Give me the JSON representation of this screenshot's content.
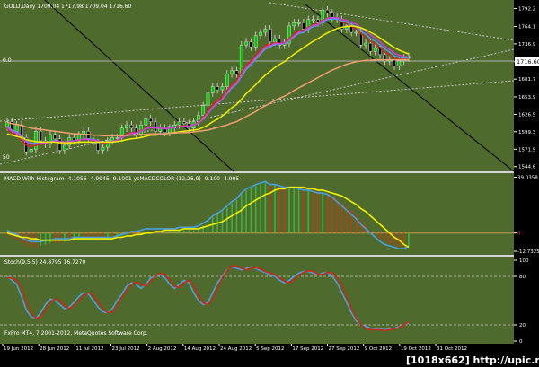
{
  "header": {
    "symbol_info": "GOLD,Daily  1709.04 1717.98 1709.04 1716.60",
    "macd_label": "MACD With Histogram -4.1056 -4.9945 -9.1001  ysMACDCOLOR (12,26,9) -9.100 -4.995",
    "stoch_label": "Stoch(9,5,5) 24.8795 16.7270",
    "copyright": "FxPro MT4, 7 2001-2012, MetaQuotes Software Corp.",
    "watermark": "[1018x662] http://upic.me/",
    "left_mark_top": "0.0",
    "left_mark_mid": "50"
  },
  "colors": {
    "panel_bg": "#4e6a2c",
    "axis_bg": "#000000",
    "candle_up": "#00c800",
    "candle_down": "#000000",
    "ma_red": "#cc2a10",
    "ma_blue": "#4aa0e0",
    "ma_magenta": "#d33fd3",
    "ma_yellow": "#f0f000",
    "ma_orange": "#f0a070",
    "macd_signal": "#f0f000",
    "macd_line": "#4aa0e0",
    "hist_green": "#3cb43c",
    "hist_red": "#c03c14",
    "stoch_main": "#4aa0e0",
    "stoch_signal": "#cc2a10",
    "current_price_badge": "#ffffff"
  },
  "chart_data": [
    {
      "type": "candlestick",
      "title": "GOLD,Daily",
      "y_ticks": [
        1792.2,
        1764.1,
        1736.9,
        1708.9,
        1681.7,
        1653.9,
        1626.5,
        1599.3,
        1571.9,
        1544.6
      ],
      "current_price": 1716.6,
      "ylim": [
        1540,
        1800
      ],
      "x_labels": [
        "19 Jun 2012",
        "28 Jun 2012",
        "11 Jul 2012",
        "23 Jul 2012",
        "2 Aug 2012",
        "14 Aug 2012",
        "24 Aug 2012",
        "5 Sep 2012",
        "17 Sep 2012",
        "27 Sep 2012",
        "9 Oct 2012",
        "19 Oct 2012",
        "31 Oct 2012"
      ],
      "series": [
        {
          "name": "close",
          "values": [
            1615,
            1600,
            1610,
            1590,
            1568,
            1572,
            1600,
            1585,
            1580,
            1595,
            1588,
            1570,
            1578,
            1590,
            1585,
            1594,
            1600,
            1588,
            1582,
            1570,
            1575,
            1585,
            1590,
            1590,
            1605,
            1610,
            1605,
            1595,
            1610,
            1620,
            1615,
            1600,
            1605,
            1598,
            1605,
            1610,
            1615,
            1612,
            1605,
            1615,
            1625,
            1640,
            1660,
            1670,
            1665,
            1670,
            1690,
            1695,
            1690,
            1735,
            1740,
            1732,
            1750,
            1755,
            1760,
            1740,
            1745,
            1735,
            1738,
            1765,
            1770,
            1770,
            1760,
            1775,
            1775,
            1770,
            1790,
            1785,
            1778,
            1775,
            1760,
            1765,
            1755,
            1755,
            1735,
            1738,
            1725,
            1730,
            1720,
            1710,
            1712,
            1702,
            1710,
            1715,
            1717
          ]
        },
        {
          "name": "ma_red",
          "values": [
            1605,
            1597,
            1594,
            1586,
            1578,
            1576,
            1578,
            1580,
            1580,
            1583,
            1585,
            1583,
            1582,
            1584,
            1585,
            1586,
            1588,
            1587,
            1586,
            1584,
            1582,
            1582,
            1584,
            1586,
            1591,
            1596,
            1598,
            1598,
            1601,
            1605,
            1607,
            1605,
            1605,
            1604,
            1605,
            1606,
            1608,
            1609,
            1608,
            1610,
            1614,
            1622,
            1632,
            1642,
            1648,
            1654,
            1664,
            1673,
            1679,
            1693,
            1704,
            1710,
            1719,
            1727,
            1735,
            1736,
            1739,
            1738,
            1738,
            1745,
            1752,
            1757,
            1758,
            1763,
            1767,
            1768,
            1774,
            1777,
            1777,
            1776,
            1771,
            1769,
            1764,
            1761,
            1753,
            1748,
            1741,
            1737,
            1731,
            1724,
            1720,
            1714,
            1713,
            1713,
            1714
          ]
        },
        {
          "name": "ma_blue",
          "values": [
            1608,
            1602,
            1599,
            1593,
            1585,
            1581,
            1581,
            1582,
            1582,
            1584,
            1586,
            1584,
            1583,
            1584,
            1585,
            1586,
            1588,
            1588,
            1587,
            1585,
            1583,
            1583,
            1584,
            1586,
            1590,
            1594,
            1597,
            1597,
            1600,
            1604,
            1606,
            1605,
            1605,
            1604,
            1605,
            1606,
            1607,
            1608,
            1608,
            1610,
            1613,
            1619,
            1628,
            1637,
            1644,
            1650,
            1659,
            1668,
            1674,
            1686,
            1697,
            1704,
            1713,
            1721,
            1729,
            1732,
            1736,
            1736,
            1737,
            1742,
            1748,
            1753,
            1755,
            1760,
            1764,
            1766,
            1771,
            1775,
            1776,
            1776,
            1773,
            1771,
            1767,
            1764,
            1757,
            1752,
            1745,
            1741,
            1735,
            1729,
            1724,
            1718,
            1716,
            1715,
            1715
          ]
        },
        {
          "name": "ma_magenta",
          "values": [
            1606,
            1600,
            1597,
            1591,
            1583,
            1580,
            1580,
            1581,
            1581,
            1583,
            1585,
            1584,
            1583,
            1584,
            1585,
            1586,
            1588,
            1587,
            1586,
            1585,
            1583,
            1583,
            1584,
            1586,
            1590,
            1594,
            1597,
            1597,
            1600,
            1604,
            1606,
            1605,
            1605,
            1604,
            1605,
            1606,
            1607,
            1608,
            1608,
            1610,
            1613,
            1620,
            1629,
            1638,
            1645,
            1651,
            1661,
            1670,
            1676,
            1689,
            1700,
            1707,
            1716,
            1724,
            1732,
            1734,
            1738,
            1737,
            1738,
            1743,
            1750,
            1755,
            1757,
            1762,
            1766,
            1767,
            1773,
            1777,
            1778,
            1778,
            1775,
            1774,
            1770,
            1768,
            1762,
            1757,
            1751,
            1746,
            1740,
            1733,
            1728,
            1722,
            1719,
            1717,
            1716
          ]
        },
        {
          "name": "ma_yellow",
          "values": [
            1596,
            1594,
            1592,
            1590,
            1587,
            1585,
            1584,
            1583,
            1583,
            1583,
            1583,
            1582,
            1582,
            1582,
            1582,
            1583,
            1583,
            1583,
            1583,
            1583,
            1583,
            1583,
            1583,
            1584,
            1585,
            1587,
            1588,
            1589,
            1590,
            1592,
            1594,
            1594,
            1595,
            1596,
            1597,
            1598,
            1599,
            1600,
            1601,
            1602,
            1603,
            1606,
            1610,
            1615,
            1619,
            1624,
            1630,
            1637,
            1642,
            1650,
            1659,
            1666,
            1673,
            1681,
            1688,
            1694,
            1700,
            1705,
            1709,
            1715,
            1721,
            1726,
            1731,
            1736,
            1741,
            1745,
            1750,
            1754,
            1758,
            1761,
            1763,
            1764,
            1765,
            1764,
            1762,
            1759,
            1755,
            1751,
            1746,
            1741,
            1736,
            1731,
            1727,
            1724,
            1721
          ]
        },
        {
          "name": "ma_orange",
          "values": [
            1614,
            1612,
            1611,
            1609,
            1607,
            1605,
            1604,
            1603,
            1602,
            1601,
            1600,
            1599,
            1598,
            1597,
            1596,
            1596,
            1595,
            1595,
            1594,
            1594,
            1593,
            1593,
            1593,
            1593,
            1593,
            1594,
            1594,
            1594,
            1595,
            1595,
            1596,
            1596,
            1596,
            1596,
            1597,
            1597,
            1598,
            1598,
            1598,
            1599,
            1600,
            1601,
            1602,
            1604,
            1606,
            1608,
            1610,
            1613,
            1615,
            1619,
            1623,
            1627,
            1631,
            1636,
            1640,
            1644,
            1648,
            1652,
            1655,
            1659,
            1664,
            1668,
            1672,
            1676,
            1680,
            1684,
            1688,
            1692,
            1696,
            1699,
            1702,
            1705,
            1707,
            1709,
            1710,
            1711,
            1711,
            1712,
            1712,
            1712,
            1712,
            1712,
            1712,
            1712,
            1712
          ]
        }
      ]
    },
    {
      "type": "bar",
      "title": "MACD With Histogram",
      "y_ticks": [
        39.0358,
        0,
        -12.7325
      ],
      "ylim": [
        -14,
        40
      ],
      "series": [
        {
          "name": "histogram",
          "values": [
            -2,
            -4,
            -5,
            -7,
            -9,
            -10,
            -10,
            -9,
            -8,
            -7,
            -7,
            -7,
            -6,
            -6,
            -5,
            -4,
            -4,
            -4,
            -4,
            -5,
            -5,
            -4,
            -4,
            -3,
            -2,
            -1,
            -1,
            -1,
            0,
            1,
            1,
            1,
            1,
            1,
            1,
            1,
            2,
            2,
            2,
            2,
            3,
            5,
            8,
            11,
            13,
            15,
            18,
            21,
            23,
            27,
            30,
            31,
            33,
            34,
            35,
            34,
            34,
            33,
            32,
            32,
            32,
            32,
            31,
            31,
            30,
            29,
            29,
            28,
            26,
            24,
            21,
            19,
            16,
            13,
            9,
            6,
            2,
            -1,
            -4,
            -6,
            -8,
            -9,
            -10,
            -10,
            -9
          ]
        },
        {
          "name": "macd_line",
          "values": [
            2,
            0,
            -1,
            -3,
            -5,
            -6,
            -6,
            -6,
            -5,
            -5,
            -4,
            -4,
            -4,
            -4,
            -3,
            -3,
            -3,
            -3,
            -3,
            -3,
            -3,
            -3,
            -3,
            -2,
            -1,
            0,
            1,
            1,
            2,
            3,
            3,
            3,
            3,
            3,
            3,
            3,
            4,
            4,
            4,
            4,
            5,
            7,
            9,
            12,
            14,
            16,
            19,
            22,
            24,
            28,
            31,
            32,
            34,
            35,
            36,
            34,
            34,
            33,
            32,
            32,
            32,
            31,
            30,
            30,
            29,
            28,
            28,
            27,
            25,
            22,
            19,
            16,
            13,
            10,
            6,
            3,
            0,
            -3,
            -6,
            -8,
            -9,
            -10,
            -11,
            -11,
            -9
          ]
        },
        {
          "name": "signal_line",
          "values": [
            0,
            -1,
            -2,
            -3,
            -3,
            -4,
            -4,
            -5,
            -5,
            -5,
            -5,
            -5,
            -5,
            -5,
            -4,
            -4,
            -4,
            -4,
            -4,
            -4,
            -4,
            -4,
            -4,
            -3,
            -3,
            -2,
            -2,
            -1,
            -1,
            0,
            0,
            1,
            1,
            2,
            2,
            2,
            2,
            3,
            3,
            3,
            3,
            4,
            5,
            6,
            7,
            8,
            10,
            12,
            14,
            16,
            19,
            21,
            23,
            25,
            27,
            28,
            30,
            31,
            31,
            32,
            32,
            32,
            32,
            31,
            31,
            30,
            30,
            29,
            28,
            27,
            26,
            24,
            22,
            20,
            17,
            15,
            12,
            9,
            6,
            3,
            0,
            -3,
            -5,
            -8,
            -10
          ]
        }
      ]
    },
    {
      "type": "line",
      "title": "Stoch(9,5,5)",
      "y_ticks": [
        100,
        80,
        20,
        0
      ],
      "ylim": [
        0,
        100
      ],
      "series": [
        {
          "name": "stoch_main",
          "values": [
            80,
            75,
            70,
            55,
            38,
            30,
            28,
            35,
            45,
            52,
            50,
            45,
            40,
            42,
            48,
            55,
            60,
            58,
            50,
            42,
            36,
            35,
            40,
            50,
            58,
            68,
            72,
            70,
            65,
            70,
            78,
            80,
            82,
            78,
            70,
            65,
            70,
            75,
            72,
            60,
            50,
            45,
            48,
            60,
            72,
            80,
            88,
            92,
            90,
            88,
            90,
            92,
            90,
            87,
            85,
            82,
            80,
            75,
            72,
            75,
            80,
            84,
            86,
            86,
            84,
            82,
            84,
            85,
            80,
            72,
            60,
            48,
            35,
            25,
            20,
            18,
            16,
            15,
            15,
            14,
            15,
            16,
            18,
            20,
            22
          ]
        },
        {
          "name": "stoch_signal",
          "values": [
            78,
            78,
            75,
            65,
            48,
            35,
            28,
            30,
            38,
            48,
            52,
            50,
            44,
            40,
            44,
            50,
            56,
            60,
            56,
            48,
            40,
            35,
            36,
            44,
            54,
            62,
            70,
            73,
            70,
            68,
            74,
            80,
            84,
            82,
            76,
            68,
            66,
            72,
            75,
            68,
            56,
            47,
            45,
            52,
            66,
            78,
            87,
            93,
            93,
            90,
            88,
            90,
            91,
            89,
            86,
            84,
            82,
            78,
            74,
            72,
            76,
            81,
            85,
            87,
            86,
            83,
            82,
            85,
            84,
            78,
            68,
            55,
            40,
            28,
            20,
            16,
            14,
            14,
            14,
            13,
            14,
            15,
            17,
            20,
            24
          ]
        }
      ]
    }
  ]
}
